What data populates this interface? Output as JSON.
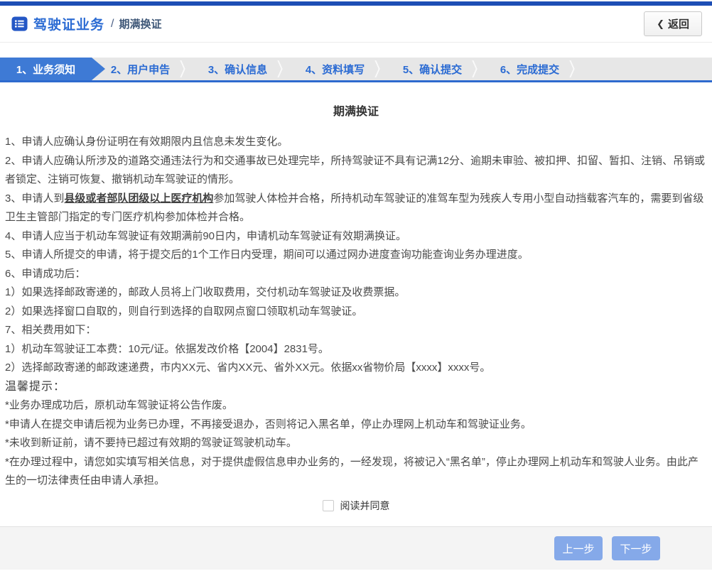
{
  "header": {
    "breadcrumb": {
      "section": "驾驶证业务",
      "separator": "/",
      "current": "期满换证"
    },
    "back_button": {
      "chevron": "❮",
      "label": "返回"
    }
  },
  "steps": [
    {
      "label": "1、业务须知",
      "state": "active"
    },
    {
      "label": "2、用户申告",
      "state": "normal"
    },
    {
      "label": "3、确认信息",
      "state": "normal"
    },
    {
      "label": "4、资料填写",
      "state": "normal"
    },
    {
      "label": "5、确认提交",
      "state": "normal"
    },
    {
      "label": "6、完成提交",
      "state": "normal"
    }
  ],
  "content": {
    "title": "期满换证",
    "notices": [
      "1、申请人应确认身份证明在有效期限内且信息未发生变化。",
      "2、申请人应确认所涉及的道路交通违法行为和交通事故已处理完毕，所持驾驶证不具有记满12分、逾期未审验、被扣押、扣留、暂扣、注销、吊销或者锁定、注销可恢复、撤销机动车驾驶证的情形。"
    ],
    "item3": {
      "prefix": "3、申请人到",
      "emphasis": "县级或者部队团级以上医疗机构",
      "suffix": "参加驾驶人体检并合格，所持机动车驾驶证的准驾车型为残疾人专用小型自动挡载客汽车的，需要到省级卫生主管部门指定的专门医疗机构参加体检并合格。"
    },
    "notices_after": [
      "4、申请人应当于机动车驾驶证有效期满前90日内，申请机动车驾驶证有效期满换证。",
      "5、申请人所提交的申请，将于提交后的1个工作日内受理，期间可以通过网办进度查询功能查询业务办理进度。",
      "6、申请成功后：",
      "1）如果选择邮政寄递的，邮政人员将上门收取费用，交付机动车驾驶证及收费票据。",
      "2）如果选择窗口自取的，则自行到选择的自取网点窗口领取机动车驾驶证。",
      "7、相关费用如下：",
      "1）机动车驾驶证工本费：10元/证。依据发改价格【2004】2831号。",
      "2）选择邮政寄递的邮政速递费，市内XX元、省内XX元、省外XX元。依据xx省物价局【xxxx】xxxx号。"
    ],
    "tips_title": "温馨提示：",
    "tips": [
      "*业务办理成功后，原机动车驾驶证将公告作废。",
      "*申请人在提交申请后视为业务已办理，不再接受退办，否则将记入黑名单，停止办理网上机动车和驾驶证业务。",
      "*未收到新证前，请不要持已超过有效期的驾驶证驾驶机动车。",
      "*在办理过程中，请您如实填写相关信息，对于提供虚假信息申办业务的，一经发现，将被记入“黑名单”，停止办理网上机动车和驾驶人业务。由此产生的一切法律责任由申请人承担。"
    ],
    "agree": {
      "label": "阅读并同意",
      "checked": false
    }
  },
  "footer": {
    "prev_label": "上一步",
    "next_label": "下一步"
  },
  "colors": {
    "topbar_blue": "#1d4eb5",
    "accent_blue": "#2b6bd3",
    "active_tab_blue": "#3e7ad5",
    "tab_bar_gray": "#e7e7e7",
    "button_blue": "#85a9e9",
    "footer_gray": "#f4f4f4",
    "body_text": "#4a4a4a"
  }
}
